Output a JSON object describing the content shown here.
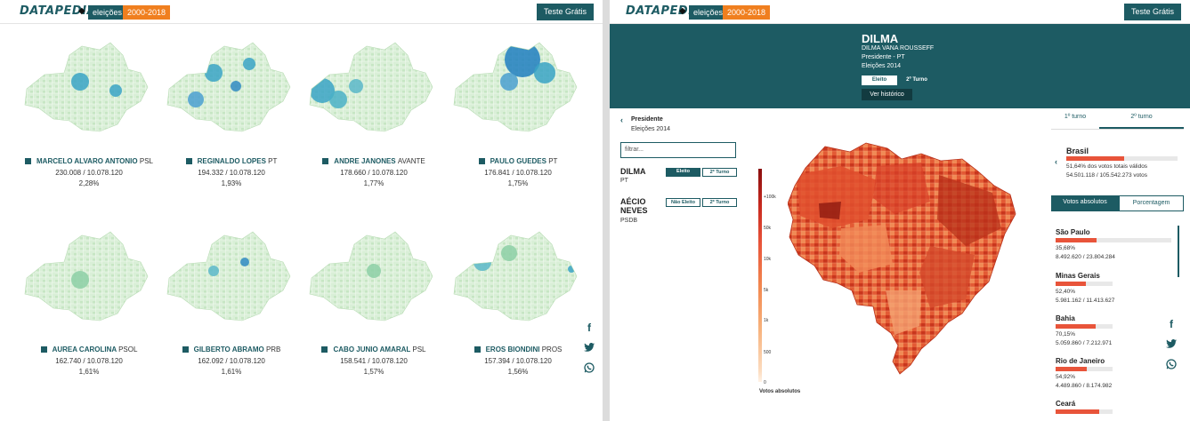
{
  "brand": {
    "logo": "DATAPEDIA",
    "section": "eleições",
    "years": "2000-2018",
    "trial_button": "Teste Grátis"
  },
  "colors": {
    "primary": "#1d5b63",
    "accent": "#f07f1f",
    "bar": "#e8543a"
  },
  "left_panel": {
    "candidates": [
      {
        "name": "MARCELO ALVARO ANTONIO",
        "party": "PSL",
        "votes": "230.008 / 10.078.120",
        "pct": "2,28%"
      },
      {
        "name": "REGINALDO LOPES",
        "party": "PT",
        "votes": "194.332 / 10.078.120",
        "pct": "1,93%"
      },
      {
        "name": "ANDRE JANONES",
        "party": "AVANTE",
        "votes": "178.660 / 10.078.120",
        "pct": "1,77%"
      },
      {
        "name": "PAULO GUEDES",
        "party": "PT",
        "votes": "176.841 / 10.078.120",
        "pct": "1,75%"
      },
      {
        "name": "AUREA CAROLINA",
        "party": "PSOL",
        "votes": "162.740 / 10.078.120",
        "pct": "1,61%"
      },
      {
        "name": "GILBERTO ABRAMO",
        "party": "PRB",
        "votes": "162.092 / 10.078.120",
        "pct": "1,61%"
      },
      {
        "name": "CABO JUNIO AMARAL",
        "party": "PSL",
        "votes": "158.541 / 10.078.120",
        "pct": "1,57%"
      },
      {
        "name": "EROS BIONDINI",
        "party": "PROS",
        "votes": "157.394 / 10.078.120",
        "pct": "1,56%"
      }
    ]
  },
  "social": {
    "facebook": "f",
    "twitter": "t",
    "whatsapp": "w"
  },
  "right_panel": {
    "hero": {
      "name": "DILMA",
      "full_name": "DILMA VANA ROUSSEFF",
      "role": "Presidente - PT",
      "election": "Eleições 2014",
      "tab_elected": "Eleito",
      "tab_second": "2º Turno",
      "history_button": "Ver histórico"
    },
    "breadcrumb": {
      "title": "Presidente",
      "subtitle": "Eleições 2014"
    },
    "filter_placeholder": "filtrar...",
    "candidates": [
      {
        "name": "DILMA",
        "party": "PT",
        "status": "Eleito",
        "turn": "2º Turno"
      },
      {
        "name_line1": "AÉCIO",
        "name_line2": "NEVES",
        "party": "PSDB",
        "status": "Não Eleito",
        "turn": "2º Turno"
      }
    ],
    "legend": {
      "ticks": [
        "+100k",
        "50k",
        "10k",
        "5k",
        "1k",
        "500",
        "0"
      ],
      "label": "Votos absolutos"
    },
    "turns": {
      "first": "1º turno",
      "second": "2º turno"
    },
    "brasil": {
      "name": "Brasil",
      "pct_text": "51,64% dos votos totais válidos",
      "votes": "54.501.118 / 105.542.273 votos",
      "fraction": 0.5164
    },
    "view_toggle": {
      "absolute": "Votos absolutos",
      "percent": "Porcentagem"
    },
    "states": [
      {
        "name": "São Paulo",
        "pct": "35,68%",
        "votes": "8.492.620 / 23.804.284",
        "fraction": 0.3568
      },
      {
        "name": "Minas Gerais",
        "pct": "52,40%",
        "votes": "5.981.162 / 11.413.627",
        "fraction": 0.524
      },
      {
        "name": "Bahia",
        "pct": "70,15%",
        "votes": "5.059.860 / 7.212.971",
        "fraction": 0.7015
      },
      {
        "name": "Rio de Janeiro",
        "pct": "54,92%",
        "votes": "4.489.860 / 8.174.982",
        "fraction": 0.5492
      },
      {
        "name": "Ceará",
        "pct": "",
        "votes": "",
        "fraction": 0.76
      }
    ]
  }
}
